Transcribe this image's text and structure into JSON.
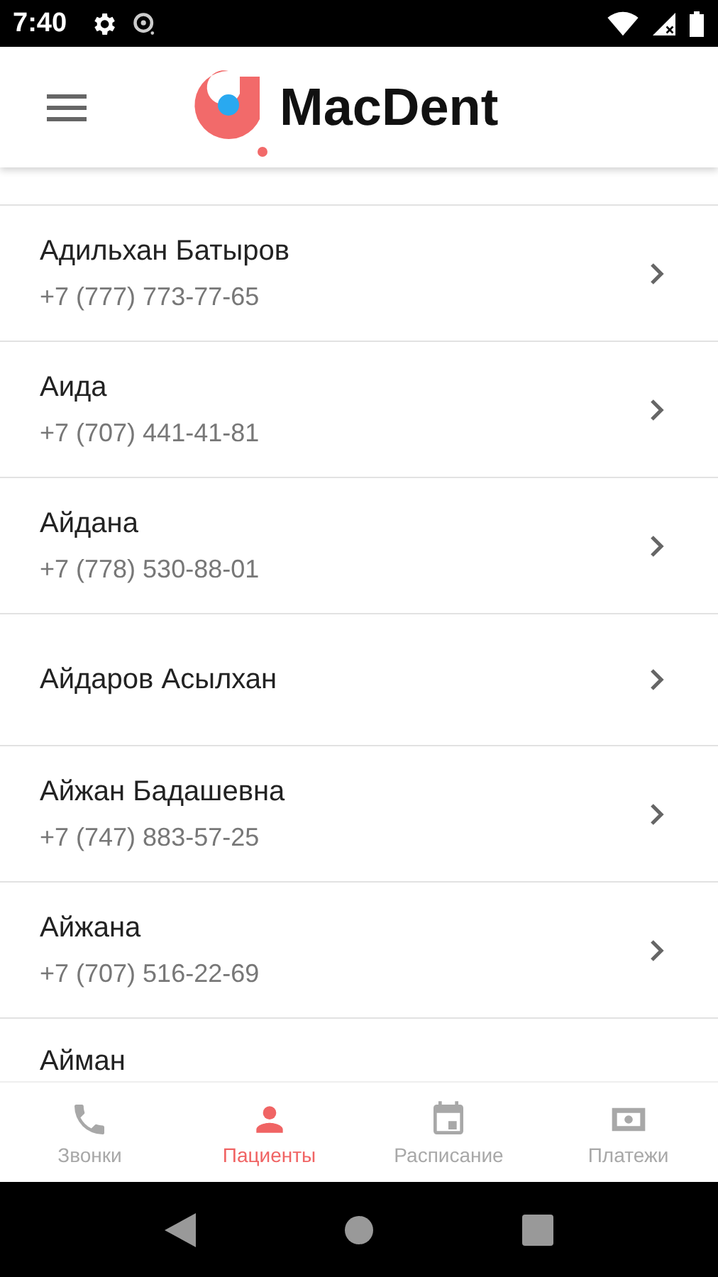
{
  "status_bar": {
    "time": "7:40"
  },
  "app_bar": {
    "title": "MacDent"
  },
  "patients": [
    {
      "kind": "contact",
      "name": "Адильхан Батыров",
      "phone": "+7 (777) 773-77-65"
    },
    {
      "kind": "contact",
      "name": "Аида",
      "phone": "+7 (707) 441-41-81"
    },
    {
      "kind": "contact",
      "name": "Айдана",
      "phone": "+7 (778) 530-88-01"
    },
    {
      "kind": "name_only",
      "name": "Айдаров Асылхан"
    },
    {
      "kind": "contact",
      "name": "Айжан Бадашевна",
      "phone": "+7 (747) 883-57-25"
    },
    {
      "kind": "contact",
      "name": "Айжана",
      "phone": "+7 (707) 516-22-69"
    },
    {
      "kind": "partial",
      "name": "Айман"
    }
  ],
  "bottom_nav": [
    {
      "kind": "phone",
      "label": "Звонки",
      "selected": false
    },
    {
      "kind": "person",
      "label": "Пациенты",
      "selected": true
    },
    {
      "kind": "calendar",
      "label": "Расписание",
      "selected": false
    },
    {
      "kind": "money",
      "label": "Платежи",
      "selected": false
    }
  ]
}
